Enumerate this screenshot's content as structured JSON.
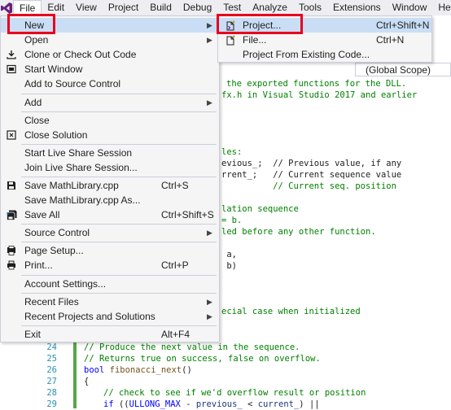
{
  "menubar": {
    "logo": "visual-studio-logo",
    "items": [
      "File",
      "Edit",
      "View",
      "Project",
      "Build",
      "Debug",
      "Test",
      "Analyze",
      "Tools",
      "Extensions",
      "Window",
      "Help"
    ]
  },
  "scope_dropdown": "(Global Scope)",
  "file_menu": {
    "items": [
      {
        "label": "New",
        "shortcut": "",
        "submenu": true,
        "icon": ""
      },
      {
        "label": "Open",
        "shortcut": "",
        "submenu": true,
        "icon": ""
      },
      {
        "label": "Clone or Check Out Code",
        "shortcut": "",
        "submenu": false,
        "icon": "clone-icon"
      },
      {
        "label": "Start Window",
        "shortcut": "",
        "submenu": false,
        "icon": "start-window-icon"
      },
      {
        "label": "Add to Source Control",
        "shortcut": "",
        "submenu": false,
        "icon": ""
      },
      {
        "label": "Add",
        "shortcut": "",
        "submenu": true,
        "icon": ""
      },
      {
        "label": "Close",
        "shortcut": "",
        "submenu": false,
        "icon": ""
      },
      {
        "label": "Close Solution",
        "shortcut": "",
        "submenu": false,
        "icon": "close-solution-icon"
      },
      {
        "label": "Start Live Share Session",
        "shortcut": "",
        "submenu": false,
        "icon": ""
      },
      {
        "label": "Join Live Share Session...",
        "shortcut": "",
        "submenu": false,
        "icon": ""
      },
      {
        "label": "Save MathLibrary.cpp",
        "shortcut": "Ctrl+S",
        "submenu": false,
        "icon": "save-icon"
      },
      {
        "label": "Save MathLibrary.cpp As...",
        "shortcut": "",
        "submenu": false,
        "icon": ""
      },
      {
        "label": "Save All",
        "shortcut": "Ctrl+Shift+S",
        "submenu": false,
        "icon": "save-all-icon"
      },
      {
        "label": "Source Control",
        "shortcut": "",
        "submenu": true,
        "icon": ""
      },
      {
        "label": "Page Setup...",
        "shortcut": "",
        "submenu": false,
        "icon": "page-setup-icon"
      },
      {
        "label": "Print...",
        "shortcut": "Ctrl+P",
        "submenu": false,
        "icon": "print-icon"
      },
      {
        "label": "Account Settings...",
        "shortcut": "",
        "submenu": false,
        "icon": ""
      },
      {
        "label": "Recent Files",
        "shortcut": "",
        "submenu": true,
        "icon": ""
      },
      {
        "label": "Recent Projects and Solutions",
        "shortcut": "",
        "submenu": true,
        "icon": ""
      },
      {
        "label": "Exit",
        "shortcut": "Alt+F4",
        "submenu": false,
        "icon": ""
      }
    ]
  },
  "new_submenu": {
    "items": [
      {
        "label": "Project...",
        "shortcut": "Ctrl+Shift+N",
        "icon": "new-project-icon"
      },
      {
        "label": "File...",
        "shortcut": "Ctrl+N",
        "icon": "new-file-icon"
      },
      {
        "label": "Project From Existing Code...",
        "shortcut": "",
        "icon": ""
      }
    ]
  },
  "code": {
    "line_numbers": [
      "24",
      "25",
      "26",
      "27",
      "28",
      "29"
    ],
    "lines": [
      "the exported functions for the DLL.",
      "fx.h in Visual Studio 2017 and earlier",
      "les:",
      "evious_;  // Previous value, if any",
      "rrent_;   // Current sequence value",
      "          // Current seq. position",
      "lation sequence",
      "= b.",
      "led before any other function.",
      " a,",
      " b)",
      "ecial case when initialized",
      "// Produce the next value in the sequence.",
      "// Returns true on success, false on overflow.",
      "bool",
      "fibonacci_next",
      "()",
      "{",
      "// check to see if we'd overflow result or position",
      "if",
      "((",
      "ULLONG_MAX",
      "- ",
      "previous_",
      " < ",
      "current_",
      ") ||"
    ]
  },
  "colors": {
    "highlight": "#c9def5",
    "annotation_red": "#e8001c",
    "comment": "#008000",
    "keyword": "#0000ff"
  }
}
